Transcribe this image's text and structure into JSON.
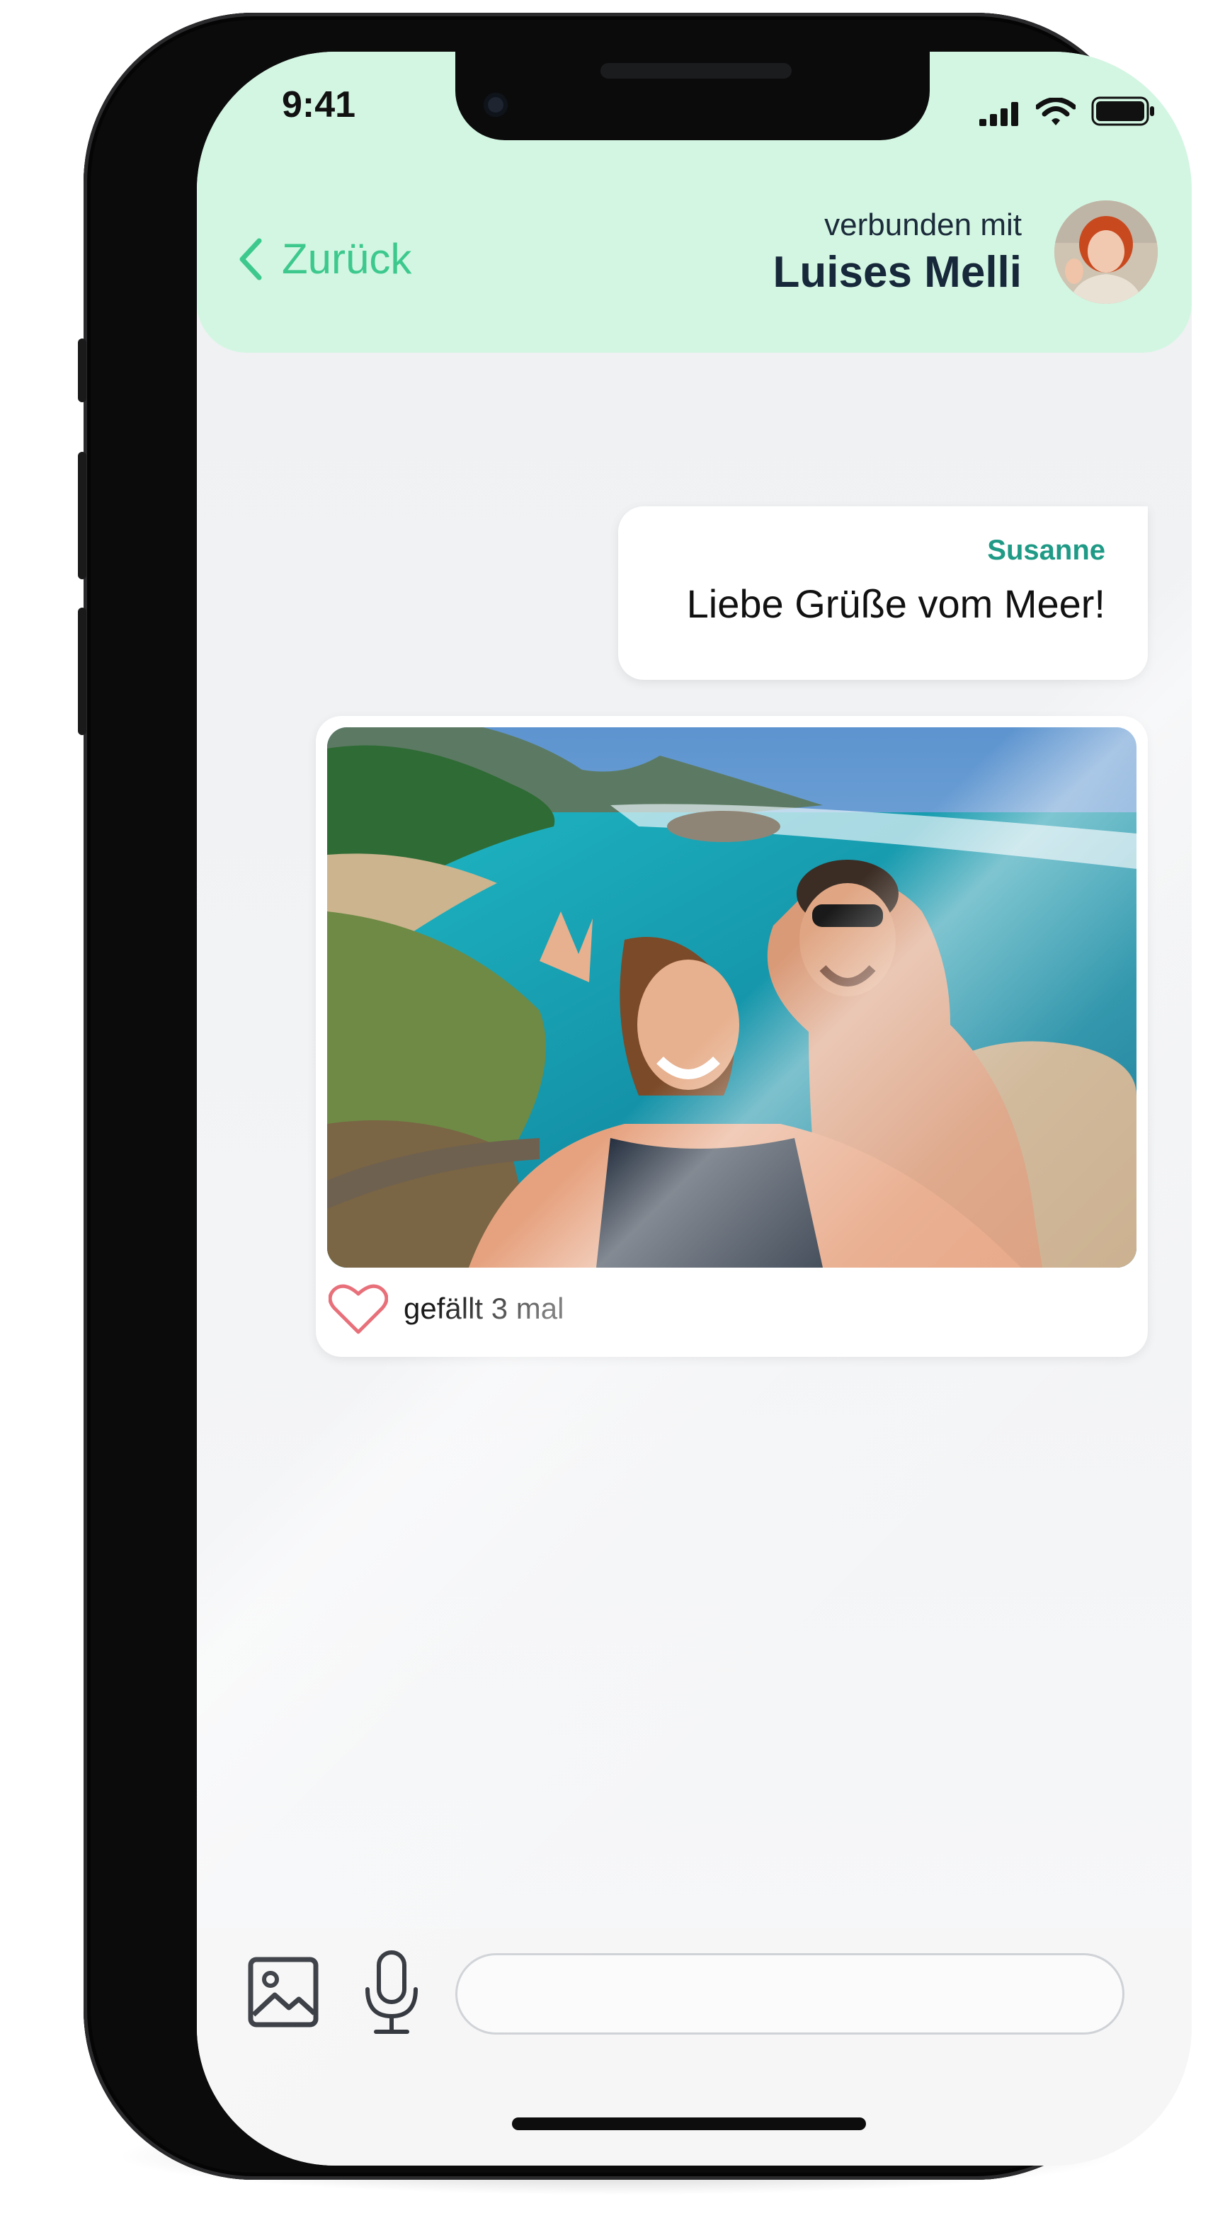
{
  "status_bar": {
    "time": "9:41"
  },
  "header": {
    "back_label": "Zurück",
    "connected_label": "verbunden mit",
    "contact_name": "Luises Melli"
  },
  "messages": [
    {
      "type": "text",
      "sender": "Susanne",
      "text": "Liebe Grüße vom Meer!"
    },
    {
      "type": "photo",
      "likes_label": "gefällt 3 mal"
    }
  ],
  "composer": {
    "value": "",
    "placeholder": ""
  },
  "colors": {
    "header_bg": "#d3f6e2",
    "accent_green": "#3dc98e",
    "sender_teal": "#1f9a86",
    "heart": "#e8707a"
  },
  "icons": [
    "chevron-left-icon",
    "signal-icon",
    "wifi-icon",
    "battery-icon",
    "heart-icon",
    "image-icon",
    "microphone-icon"
  ]
}
